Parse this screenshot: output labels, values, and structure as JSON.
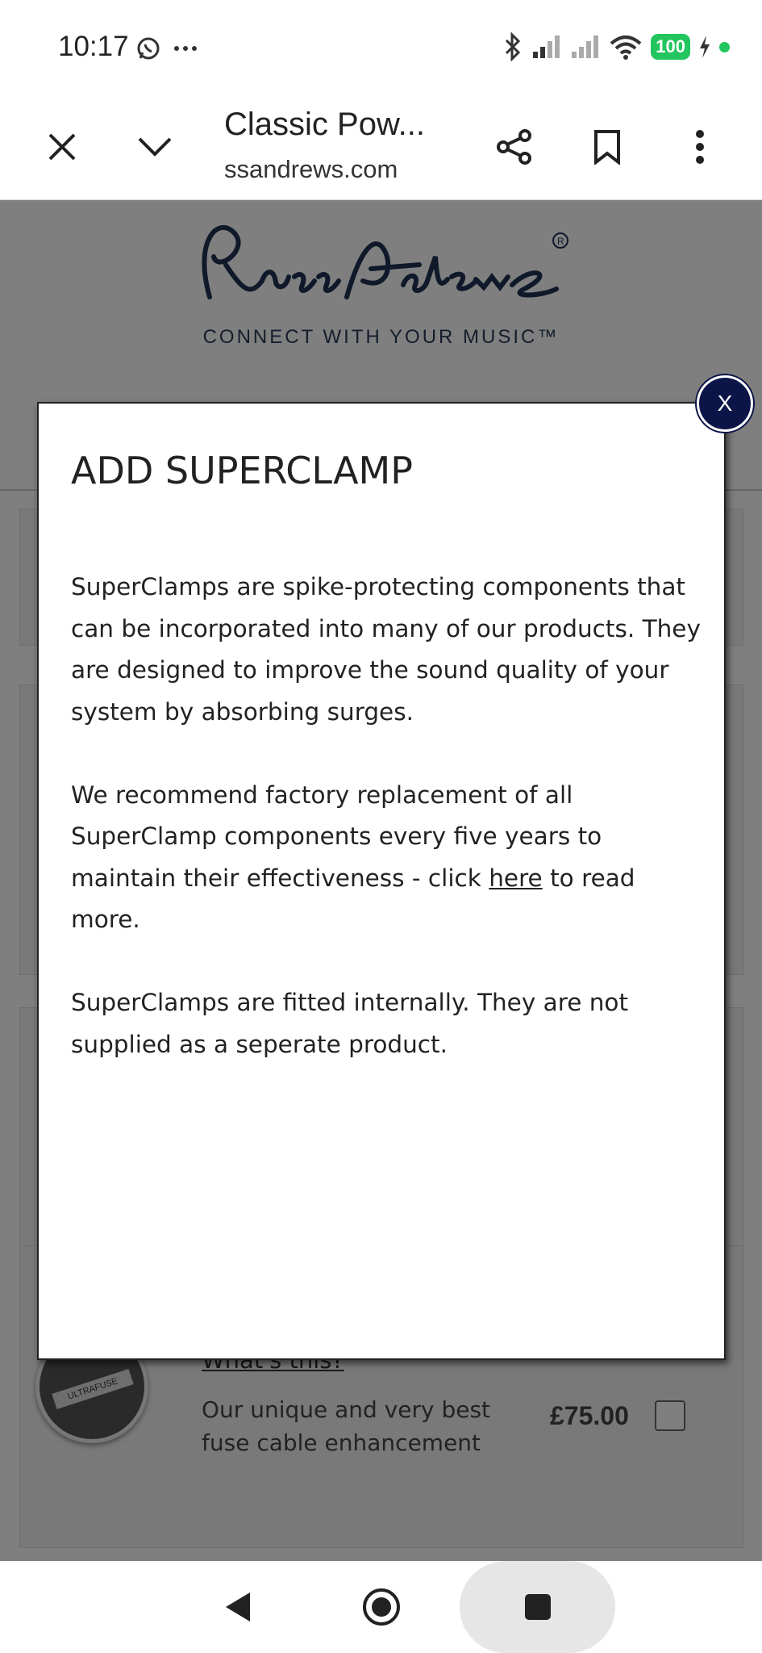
{
  "status_bar": {
    "time": "10:17",
    "battery": "100",
    "icons": [
      "whatsapp-icon",
      "more-dots-icon",
      "bluetooth-icon",
      "signal-icon",
      "signal-icon",
      "wifi-icon",
      "charging-icon"
    ]
  },
  "browser": {
    "title": "Classic Pow...",
    "url": "ssandrews.com"
  },
  "site": {
    "tagline": "CONNECT WITH YOUR MUSIC™",
    "whats_this": "What's this?",
    "fuse_description": "Our unique and very best fuse cable enhancement",
    "fuse_label": "ULTRAFUSE",
    "price": "£75.00"
  },
  "modal": {
    "title": "ADD SUPERCLAMP",
    "para1": "SuperClamps are spike-protecting components that can be incorporated into many of our products. They are designed to improve the sound quality of your system by absorbing surges.",
    "para2_before": "We recommend factory replacement of all SuperClamp components every five years to maintain their effectiveness - click ",
    "para2_link": "here",
    "para2_after": " to read more.",
    "para3": "SuperClamps are fitted internally. They are not supplied as a seperate product.",
    "close_label": "X"
  },
  "colors": {
    "close_button": "#0b1548",
    "logo": "#1e3355",
    "battery": "#22c55e"
  }
}
